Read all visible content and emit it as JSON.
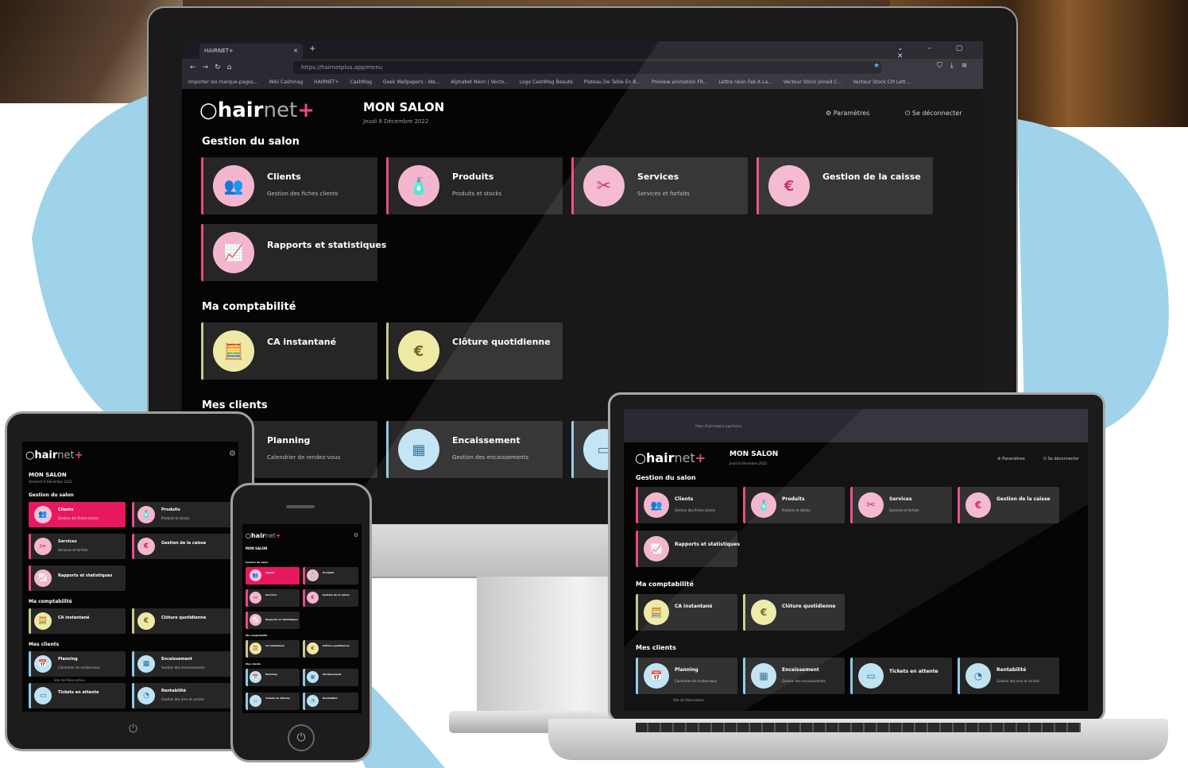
{
  "browser": {
    "tab_title": "HAIRNET+",
    "url": "https://hairnetplus.app/menu",
    "bookmarks": [
      "Importer les marque-pages...",
      "Wiki Cashmag",
      "HAIRNET+",
      "CashMag",
      "Geek Wallpapers - Wa...",
      "Alphabet Néon | Vecto...",
      "Logo CashMag Beauté",
      "Plateau De Table En B...",
      "Preview animation FR...",
      "Lettre néon Fab A La...",
      "Vecteur Stock joined C...",
      "Vecteur Stock CM Lett..."
    ]
  },
  "app": {
    "logo_bold": "hair",
    "logo_thin": "net",
    "logo_plus": "+",
    "salon_title": "MON SALON",
    "date": "Jeudi 8 Décembre 2022",
    "tablet_date": "Vendredi 9 Décembre 2022",
    "settings_label": "Paramètres",
    "logout_label": "Se déconnecter",
    "sections": {
      "salon": "Gestion du salon",
      "compta": "Ma comptabilité",
      "clients": "Mes clients"
    },
    "cards": {
      "clients": {
        "title": "Clients",
        "desc": "Gestion des fiches clients"
      },
      "produits": {
        "title": "Produits",
        "desc": "Produits et stocks"
      },
      "services": {
        "title": "Services",
        "desc": "Services et forfaits"
      },
      "caisse": {
        "title": "Gestion de la caisse",
        "desc": ""
      },
      "rapports": {
        "title": "Rapports et statistiques",
        "desc": ""
      },
      "ca": {
        "title": "CA instantané",
        "desc": ""
      },
      "cloture": {
        "title": "Clôture quotidienne",
        "desc": ""
      },
      "planning": {
        "title": "Planning",
        "desc": "Calendrier de rendez-vous"
      },
      "encaissement": {
        "title": "Encaissement",
        "desc": "Gestion des encaissements"
      },
      "tickets": {
        "title": "Tickets en attente",
        "desc": ""
      },
      "rentabilite": {
        "title": "Rentabilité",
        "desc": "Gestion des arns et arrivés"
      }
    },
    "site_reservation": "Site de Réservation"
  },
  "icons": [
    "people-icon",
    "spray-bottle-icon",
    "scissors-icon",
    "coins-icon",
    "chart-icon",
    "calculator-icon",
    "euro-cycle-icon",
    "calendar-icon",
    "cash-register-icon",
    "ticket-icon",
    "pie-icon",
    "gear-icon",
    "power-icon"
  ],
  "colors": {
    "accent": "#e8488a",
    "compta": "#c9c98a",
    "clients": "#8ec9e6",
    "bg": "#050505",
    "card": "#262626"
  }
}
